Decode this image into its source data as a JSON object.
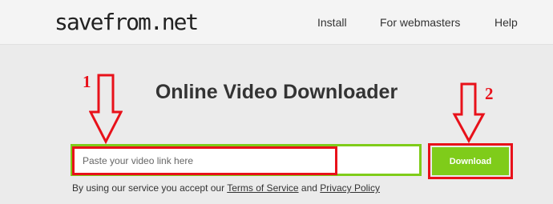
{
  "header": {
    "logo": "savefrom.net",
    "nav": [
      "Install",
      "For webmasters",
      "Help"
    ]
  },
  "main": {
    "title": "Online Video Downloader",
    "input_placeholder": "Paste your video link here",
    "input_value": "",
    "download_label": "Download",
    "terms_prefix": "By using our service you accept our ",
    "terms_link": "Terms of Service",
    "terms_and": " and ",
    "privacy_link": "Privacy Policy"
  },
  "annotations": {
    "step1": "1",
    "step2": "2",
    "accent_color": "#e8111a",
    "brand_green": "#7fcc1a"
  }
}
